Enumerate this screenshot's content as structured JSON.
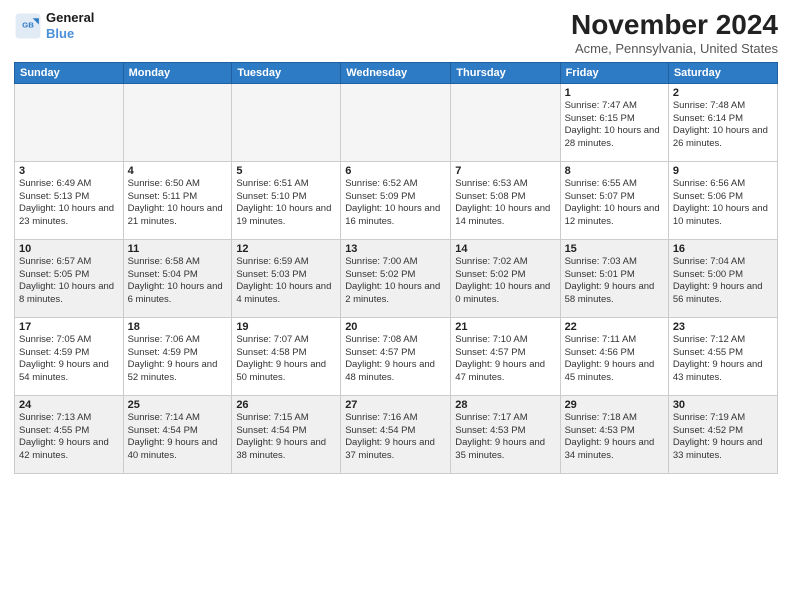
{
  "header": {
    "logo_line1": "General",
    "logo_line2": "Blue",
    "month": "November 2024",
    "location": "Acme, Pennsylvania, United States"
  },
  "weekdays": [
    "Sunday",
    "Monday",
    "Tuesday",
    "Wednesday",
    "Thursday",
    "Friday",
    "Saturday"
  ],
  "weeks": [
    [
      {
        "day": "",
        "empty": true
      },
      {
        "day": "",
        "empty": true
      },
      {
        "day": "",
        "empty": true
      },
      {
        "day": "",
        "empty": true
      },
      {
        "day": "",
        "empty": true
      },
      {
        "day": "1",
        "sunrise": "7:47 AM",
        "sunset": "6:15 PM",
        "daylight": "10 hours and 28 minutes."
      },
      {
        "day": "2",
        "sunrise": "7:48 AM",
        "sunset": "6:14 PM",
        "daylight": "10 hours and 26 minutes."
      }
    ],
    [
      {
        "day": "3",
        "sunrise": "6:49 AM",
        "sunset": "5:13 PM",
        "daylight": "10 hours and 23 minutes."
      },
      {
        "day": "4",
        "sunrise": "6:50 AM",
        "sunset": "5:11 PM",
        "daylight": "10 hours and 21 minutes."
      },
      {
        "day": "5",
        "sunrise": "6:51 AM",
        "sunset": "5:10 PM",
        "daylight": "10 hours and 19 minutes."
      },
      {
        "day": "6",
        "sunrise": "6:52 AM",
        "sunset": "5:09 PM",
        "daylight": "10 hours and 16 minutes."
      },
      {
        "day": "7",
        "sunrise": "6:53 AM",
        "sunset": "5:08 PM",
        "daylight": "10 hours and 14 minutes."
      },
      {
        "day": "8",
        "sunrise": "6:55 AM",
        "sunset": "5:07 PM",
        "daylight": "10 hours and 12 minutes."
      },
      {
        "day": "9",
        "sunrise": "6:56 AM",
        "sunset": "5:06 PM",
        "daylight": "10 hours and 10 minutes."
      }
    ],
    [
      {
        "day": "10",
        "sunrise": "6:57 AM",
        "sunset": "5:05 PM",
        "daylight": "10 hours and 8 minutes.",
        "shaded": true
      },
      {
        "day": "11",
        "sunrise": "6:58 AM",
        "sunset": "5:04 PM",
        "daylight": "10 hours and 6 minutes.",
        "shaded": true
      },
      {
        "day": "12",
        "sunrise": "6:59 AM",
        "sunset": "5:03 PM",
        "daylight": "10 hours and 4 minutes.",
        "shaded": true
      },
      {
        "day": "13",
        "sunrise": "7:00 AM",
        "sunset": "5:02 PM",
        "daylight": "10 hours and 2 minutes.",
        "shaded": true
      },
      {
        "day": "14",
        "sunrise": "7:02 AM",
        "sunset": "5:02 PM",
        "daylight": "10 hours and 0 minutes.",
        "shaded": true
      },
      {
        "day": "15",
        "sunrise": "7:03 AM",
        "sunset": "5:01 PM",
        "daylight": "9 hours and 58 minutes.",
        "shaded": true
      },
      {
        "day": "16",
        "sunrise": "7:04 AM",
        "sunset": "5:00 PM",
        "daylight": "9 hours and 56 minutes.",
        "shaded": true
      }
    ],
    [
      {
        "day": "17",
        "sunrise": "7:05 AM",
        "sunset": "4:59 PM",
        "daylight": "9 hours and 54 minutes."
      },
      {
        "day": "18",
        "sunrise": "7:06 AM",
        "sunset": "4:59 PM",
        "daylight": "9 hours and 52 minutes."
      },
      {
        "day": "19",
        "sunrise": "7:07 AM",
        "sunset": "4:58 PM",
        "daylight": "9 hours and 50 minutes."
      },
      {
        "day": "20",
        "sunrise": "7:08 AM",
        "sunset": "4:57 PM",
        "daylight": "9 hours and 48 minutes."
      },
      {
        "day": "21",
        "sunrise": "7:10 AM",
        "sunset": "4:57 PM",
        "daylight": "9 hours and 47 minutes."
      },
      {
        "day": "22",
        "sunrise": "7:11 AM",
        "sunset": "4:56 PM",
        "daylight": "9 hours and 45 minutes."
      },
      {
        "day": "23",
        "sunrise": "7:12 AM",
        "sunset": "4:55 PM",
        "daylight": "9 hours and 43 minutes."
      }
    ],
    [
      {
        "day": "24",
        "sunrise": "7:13 AM",
        "sunset": "4:55 PM",
        "daylight": "9 hours and 42 minutes.",
        "shaded": true
      },
      {
        "day": "25",
        "sunrise": "7:14 AM",
        "sunset": "4:54 PM",
        "daylight": "9 hours and 40 minutes.",
        "shaded": true
      },
      {
        "day": "26",
        "sunrise": "7:15 AM",
        "sunset": "4:54 PM",
        "daylight": "9 hours and 38 minutes.",
        "shaded": true
      },
      {
        "day": "27",
        "sunrise": "7:16 AM",
        "sunset": "4:54 PM",
        "daylight": "9 hours and 37 minutes.",
        "shaded": true
      },
      {
        "day": "28",
        "sunrise": "7:17 AM",
        "sunset": "4:53 PM",
        "daylight": "9 hours and 35 minutes.",
        "shaded": true
      },
      {
        "day": "29",
        "sunrise": "7:18 AM",
        "sunset": "4:53 PM",
        "daylight": "9 hours and 34 minutes.",
        "shaded": true
      },
      {
        "day": "30",
        "sunrise": "7:19 AM",
        "sunset": "4:52 PM",
        "daylight": "9 hours and 33 minutes.",
        "shaded": true
      }
    ]
  ]
}
